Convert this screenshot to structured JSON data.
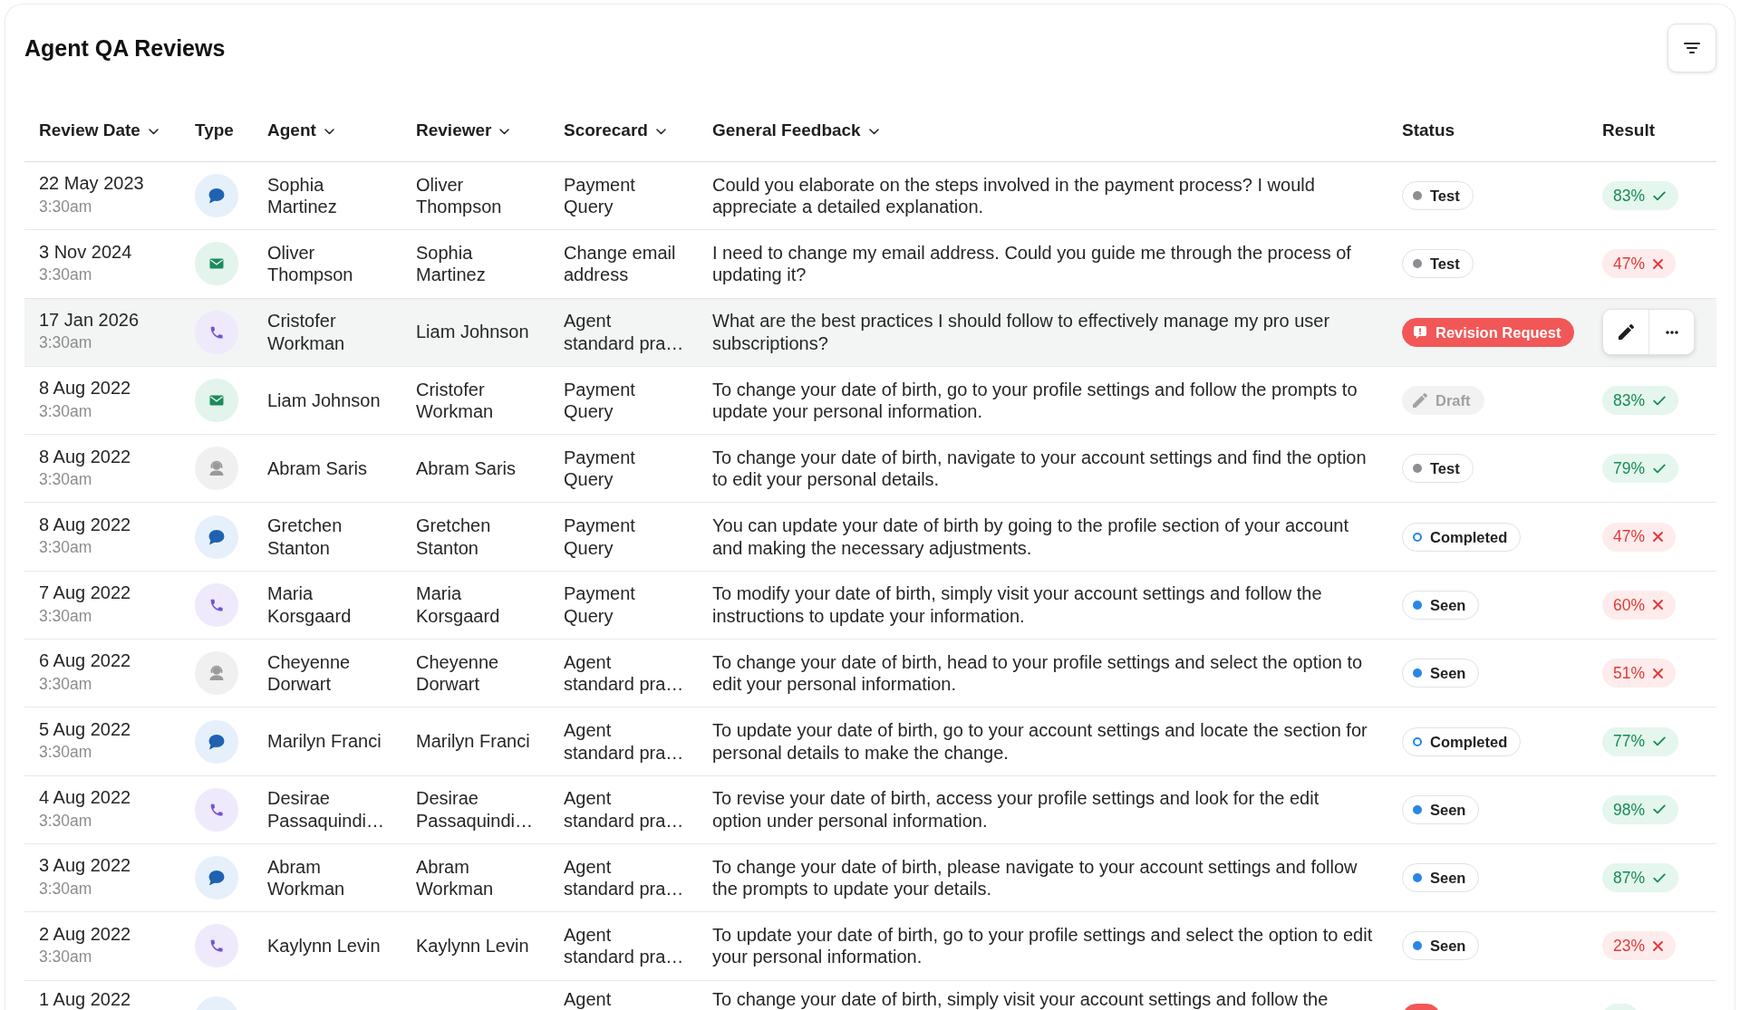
{
  "title": "Agent QA Reviews",
  "columns": [
    {
      "label": "Review Date",
      "sortable": true
    },
    {
      "label": "Type",
      "sortable": false
    },
    {
      "label": "Agent",
      "sortable": true
    },
    {
      "label": "Reviewer",
      "sortable": true
    },
    {
      "label": "Scorecard",
      "sortable": true
    },
    {
      "label": "General Feedback",
      "sortable": true
    },
    {
      "label": "Status",
      "sortable": false
    },
    {
      "label": "Result",
      "sortable": false
    }
  ],
  "rows": [
    {
      "date": "22 May 2023",
      "time": "3:30am",
      "kind": "chat",
      "agent": "Sophia Martinez",
      "reviewer": "Oliver Thompson",
      "scorecard": "Payment Query",
      "feedback": "Could you elaborate on the steps involved in the payment process? I would appreciate a detailed explanation.",
      "status": {
        "kind": "test",
        "label": "Test"
      },
      "result": {
        "label": "83%",
        "passed": true
      },
      "highlighted": false
    },
    {
      "date": "3 Nov 2024",
      "time": "3:30am",
      "kind": "email",
      "agent": "Oliver Thompson",
      "reviewer": "Sophia Martinez",
      "scorecard": "Change email address",
      "feedback": "I need to change my email address. Could you guide me through the process of updating it?",
      "status": {
        "kind": "test",
        "label": "Test"
      },
      "result": {
        "label": "47%",
        "passed": false
      },
      "highlighted": false
    },
    {
      "date": "17 Jan 2026",
      "time": "3:30am",
      "kind": "phone",
      "agent": "Cristofer Workman",
      "reviewer": "Liam Johnson",
      "scorecard": "Agent standard pra…",
      "feedback": "What are the best practices I should follow to effectively manage my pro user subscriptions?",
      "status": {
        "kind": "revision",
        "label": "Revision Request"
      },
      "highlighted": true
    },
    {
      "date": "8 Aug 2022",
      "time": "3:30am",
      "kind": "email",
      "agent": "Liam Johnson",
      "reviewer": "Cristofer Workman",
      "scorecard": "Payment Query",
      "feedback": "To change your date of birth, go to your profile settings and follow the prompts to update your personal information.",
      "status": {
        "kind": "draft",
        "label": "Draft"
      },
      "result": {
        "label": "83%",
        "passed": true
      },
      "highlighted": false
    },
    {
      "date": "8 Aug 2022",
      "time": "3:30am",
      "kind": "agent",
      "agent": "Abram Saris",
      "reviewer": "Abram Saris",
      "scorecard": "Payment Query",
      "feedback": "To change your date of birth, navigate to your account settings and find the option to edit your personal details.",
      "status": {
        "kind": "test",
        "label": "Test"
      },
      "result": {
        "label": "79%",
        "passed": true
      },
      "highlighted": false
    },
    {
      "date": "8 Aug 2022",
      "time": "3:30am",
      "kind": "chat",
      "agent": "Gretchen Stanton",
      "reviewer": "Gretchen Stanton",
      "scorecard": "Payment Query",
      "feedback": "You can update your date of birth by going to the profile section of your account and making the necessary adjustments.",
      "status": {
        "kind": "completed",
        "label": "Completed"
      },
      "result": {
        "label": "47%",
        "passed": false
      },
      "highlighted": false
    },
    {
      "date": "7 Aug 2022",
      "time": "3:30am",
      "kind": "phone",
      "agent": "Maria Korsgaard",
      "reviewer": "Maria Korsgaard",
      "scorecard": "Payment Query",
      "feedback": "To modify your date of birth, simply visit your account settings and follow the instructions to update your information.",
      "status": {
        "kind": "seen",
        "label": "Seen"
      },
      "result": {
        "label": "60%",
        "passed": false
      },
      "highlighted": false
    },
    {
      "date": "6 Aug 2022",
      "time": "3:30am",
      "kind": "agent",
      "agent": "Cheyenne Dorwart",
      "reviewer": "Cheyenne Dorwart",
      "scorecard": "Agent standard pra…",
      "feedback": "To change your date of birth, head to your profile settings and select the option to edit your personal information.",
      "status": {
        "kind": "seen",
        "label": "Seen"
      },
      "result": {
        "label": "51%",
        "passed": false
      },
      "highlighted": false
    },
    {
      "date": "5 Aug 2022",
      "time": "3:30am",
      "kind": "chat",
      "agent": "Marilyn Franci",
      "reviewer": "Marilyn Franci",
      "scorecard": "Agent standard pra…",
      "feedback": "To update your date of birth, go to your account settings and locate the section for personal details to make the change.",
      "status": {
        "kind": "completed",
        "label": "Completed"
      },
      "result": {
        "label": "77%",
        "passed": true
      },
      "highlighted": false
    },
    {
      "date": "4 Aug 2022",
      "time": "3:30am",
      "kind": "phone",
      "agent": "Desirae Passaquindi…",
      "reviewer": "Desirae Passaquindi…",
      "scorecard": "Agent standard pra…",
      "feedback": "To revise your date of birth, access your profile settings and look for the edit option under personal information.",
      "status": {
        "kind": "seen",
        "label": "Seen"
      },
      "result": {
        "label": "98%",
        "passed": true
      },
      "highlighted": false
    },
    {
      "date": "3 Aug 2022",
      "time": "3:30am",
      "kind": "chat",
      "agent": "Abram Workman",
      "reviewer": "Abram Workman",
      "scorecard": "Agent standard pra…",
      "feedback": "To change your date of birth, please navigate to your account settings and follow the prompts to update your details.",
      "status": {
        "kind": "seen",
        "label": "Seen"
      },
      "result": {
        "label": "87%",
        "passed": true
      },
      "highlighted": false
    },
    {
      "date": "2 Aug 2022",
      "time": "3:30am",
      "kind": "phone",
      "agent": "Kaylynn Levin",
      "reviewer": "Kaylynn Levin",
      "scorecard": "Agent standard pra…",
      "feedback": "To update your date of birth, go to your profile settings and select the option to edit your personal information.",
      "status": {
        "kind": "seen",
        "label": "Seen"
      },
      "result": {
        "label": "23%",
        "passed": false
      },
      "highlighted": false
    },
    {
      "date": "1 Aug 2022",
      "kind": "chat",
      "scorecard": "Agent",
      "feedback": "To change your date of birth, simply visit your account settings and follow the",
      "status": {
        "kind": "revision"
      },
      "result": {
        "passed": true
      },
      "highlighted": false
    }
  ]
}
